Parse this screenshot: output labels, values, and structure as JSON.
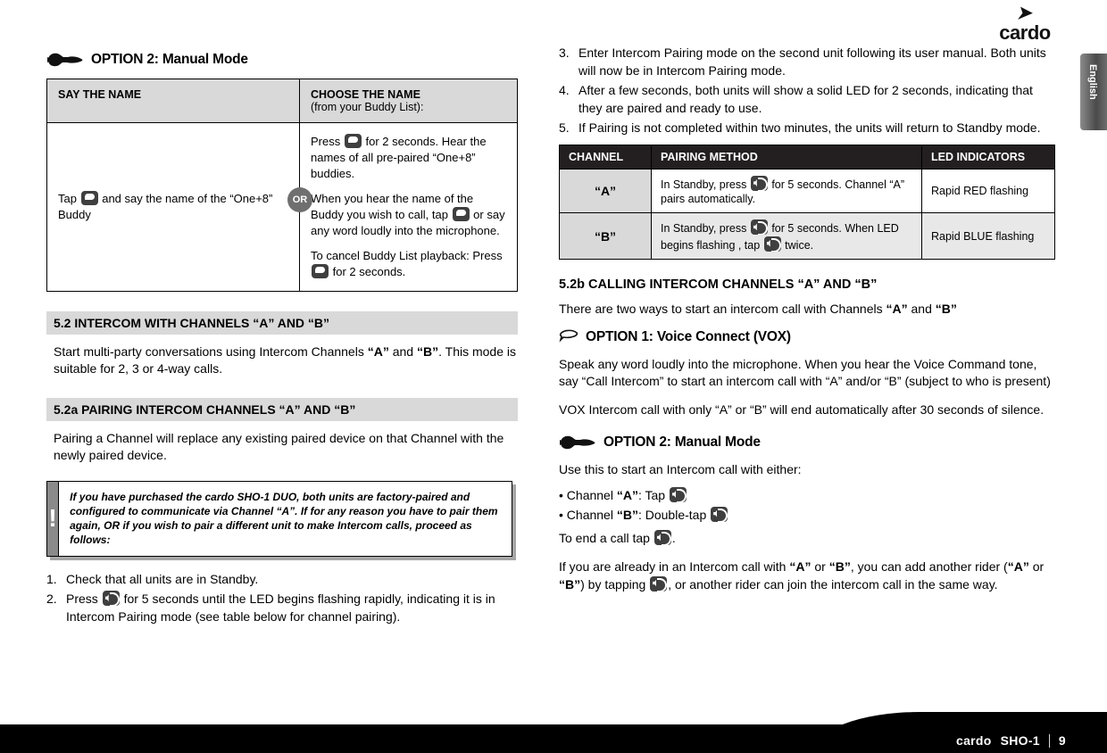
{
  "brand": {
    "logo_word": "cardo",
    "side_tab": "English"
  },
  "left": {
    "option2": {
      "title": "OPTION 2: Manual Mode",
      "icon": "pointing-hand-icon"
    },
    "table": {
      "headers": {
        "say": "SAY THE NAME",
        "choose": "CHOOSE THE NAME",
        "choose_sub": "(from your Buddy List):"
      },
      "or_badge": "OR",
      "left_cell": {
        "pre": "Tap",
        "post": "and say the name of the “One+8” Buddy"
      },
      "right_cell": {
        "p1_pre": "Press",
        "p1_post": "for 2 seconds. Hear the names of all pre-paired “One+8” buddies.",
        "p2_pre": "When you hear the name of the Buddy you wish to call, tap",
        "p2_post": "or say any word loudly into the microphone.",
        "p3_pre": "To cancel Buddy List playback: Press",
        "p3_post": "for 2 seconds."
      }
    },
    "s52": {
      "heading": "5.2 INTERCOM WITH CHANNELS “A” AND “B”",
      "body_1": "Start multi-party conversations using Intercom Channels ",
      "body_bold_a": "“A”",
      "body_2": " and ",
      "body_bold_b": "“B”",
      "body_3": ". This mode is suitable for 2, 3 or 4-way calls."
    },
    "s52a": {
      "heading": "5.2a PAIRING INTERCOM CHANNELS “A” AND “B”",
      "body": "Pairing a Channel will replace any existing paired device on that Channel with the newly paired device."
    },
    "note": {
      "mark": "!",
      "text": "If you have purchased the cardo SHO-1 DUO, both units are factory-paired and configured to communicate via Channel “A”. If for any reason you have to pair them again, OR if you wish to pair a different unit to make Intercom calls, proceed as follows:"
    },
    "steps": [
      {
        "num": "1.",
        "text": "Check that all units are in Standby."
      },
      {
        "num": "2.",
        "pre": "Press",
        "post": "for 5 seconds until the LED begins flashing rapidly, indicating it is in Intercom Pairing mode (see table below for channel pairing)."
      }
    ]
  },
  "right": {
    "steps": [
      {
        "num": "3.",
        "text": "Enter Intercom Pairing mode on the second unit following its user manual. Both units will now be in Intercom Pairing mode."
      },
      {
        "num": "4.",
        "text": "After a few seconds, both units will show a solid LED for 2 seconds, indicating that they are paired and ready to use."
      },
      {
        "num": "5.",
        "text": "If Pairing is not completed within two minutes, the units will return to Standby mode."
      }
    ],
    "channel_table": {
      "headers": [
        "CHANNEL",
        "PAIRING METHOD",
        "LED INDICATORS"
      ],
      "rows": [
        {
          "channel": "“A”",
          "method_pre": "In Standby, press",
          "method_post": "for 5 seconds. Channel “A” pairs automatically.",
          "led": "Rapid RED flashing"
        },
        {
          "channel": "“B”",
          "method_pre": "In Standby, press",
          "method_mid": "for 5 seconds. When LED begins flashing , tap",
          "method_post": "twice.",
          "led": "Rapid BLUE flashing"
        }
      ]
    },
    "s52b": {
      "heading": "5.2b CALLING INTERCOM CHANNELS “A” AND “B”",
      "body_1": "There are two ways to start an intercom call with Channels ",
      "body_bold_a": "“A”",
      "body_2": " and ",
      "body_bold_b": "“B”"
    },
    "option1": {
      "title": "OPTION 1: Voice Connect (VOX)",
      "icon": "voice-vox-icon",
      "p1": "Speak any word loudly into the microphone. When you hear the Voice Command tone, say “Call Intercom” to start an intercom call with “A” and/or “B” (subject to who is present)",
      "p2": "VOX Intercom call with only “A” or “B” will end automatically after 30 seconds of silence."
    },
    "option2": {
      "title": "OPTION 2: Manual Mode",
      "icon": "pointing-hand-icon",
      "intro": "Use this to start an Intercom call with either:",
      "bullets": [
        {
          "pre": "Channel ",
          "bold": "“A”",
          "post": ": Tap"
        },
        {
          "pre": "Channel ",
          "bold": "“B”",
          "post": ": Double-tap"
        }
      ],
      "end_pre": "To end a call tap",
      "end_post": ".",
      "p_final_1": "If you are already in an Intercom call with ",
      "p_final_bold_a": "“A”",
      "p_final_2": " or ",
      "p_final_bold_b": "“B”",
      "p_final_3": ", you can add another rider (",
      "p_final_bold_a2": "“A”",
      "p_final_4": " or ",
      "p_final_bold_b2": "“B”",
      "p_final_5": ") by tapping",
      "p_final_6": ", or another rider can join the intercom call in the same way."
    }
  },
  "footer": {
    "brand": "cardo",
    "model": "SHO-1",
    "page": "9"
  }
}
